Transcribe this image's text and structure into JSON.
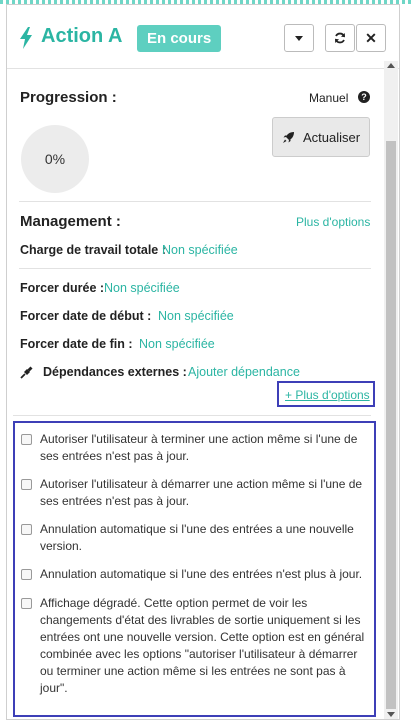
{
  "header": {
    "title": "Action A",
    "status": "En cours",
    "accent_color": "#2bb5a3",
    "badge_color": "#5ecfc0",
    "icons": [
      "bolt-icon",
      "caret-down-icon",
      "refresh-icon",
      "close-icon"
    ]
  },
  "progression": {
    "title": "Progression :",
    "mode": "Manuel",
    "percent_label": "0%",
    "refresh_label": "Actualiser"
  },
  "management": {
    "title": "Management :",
    "more_options": "Plus d'options",
    "charge_label": "Charge de travail totale :",
    "charge_value": "Non spécifiée",
    "duree_label": "Forcer durée :",
    "duree_value": "Non spécifiée",
    "debut_label": "Forcer date de début :",
    "debut_value": "Non spécifiée",
    "fin_label": "Forcer date de fin :",
    "fin_value": "Non spécifiée",
    "deps_label": "Dépendances externes :",
    "deps_value": "Ajouter dépendance",
    "plus_options_link": "+ Plus d'options"
  },
  "options": [
    {
      "label": "Autoriser l'utilisateur à terminer une action même si l'une de ses entrées n'est pas à jour.",
      "checked": false
    },
    {
      "label": "Autoriser l'utilisateur à démarrer une action même si l'une de ses entrées n'est pas à jour.",
      "checked": false
    },
    {
      "label": "Annulation automatique si l'une des entrées a une nouvelle version.",
      "checked": false
    },
    {
      "label": "Annulation automatique si l'une des entrées n'est plus à jour.",
      "checked": false
    },
    {
      "label": "Affichage dégradé. Cette option permet de voir les changements d'état des livrables de sortie uniquement si les entrées ont une nouvelle version. Cette option est en général combinée avec les options \"autoriser l'utilisateur à démarrer ou terminer une action même si les entrées ne sont pas à jour\".",
      "checked": false
    }
  ]
}
